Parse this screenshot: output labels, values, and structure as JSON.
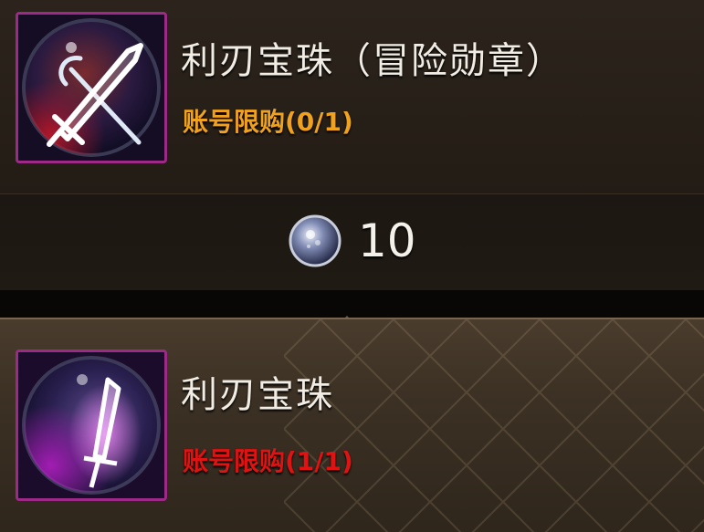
{
  "items": [
    {
      "title": "利刃宝珠（冒险勋章）",
      "limit": "账号限购(0/1)",
      "limit_color": "#f0a21e",
      "icon": "crossed-swords-orb-icon",
      "price": {
        "currency_icon": "silver-orb-coin-icon",
        "value": "10"
      }
    },
    {
      "title": "利刃宝珠",
      "limit": "账号限购(1/1)",
      "limit_color": "#e01212",
      "icon": "purple-sword-orb-icon"
    }
  ],
  "colors": {
    "frame": "#9c2a86"
  }
}
